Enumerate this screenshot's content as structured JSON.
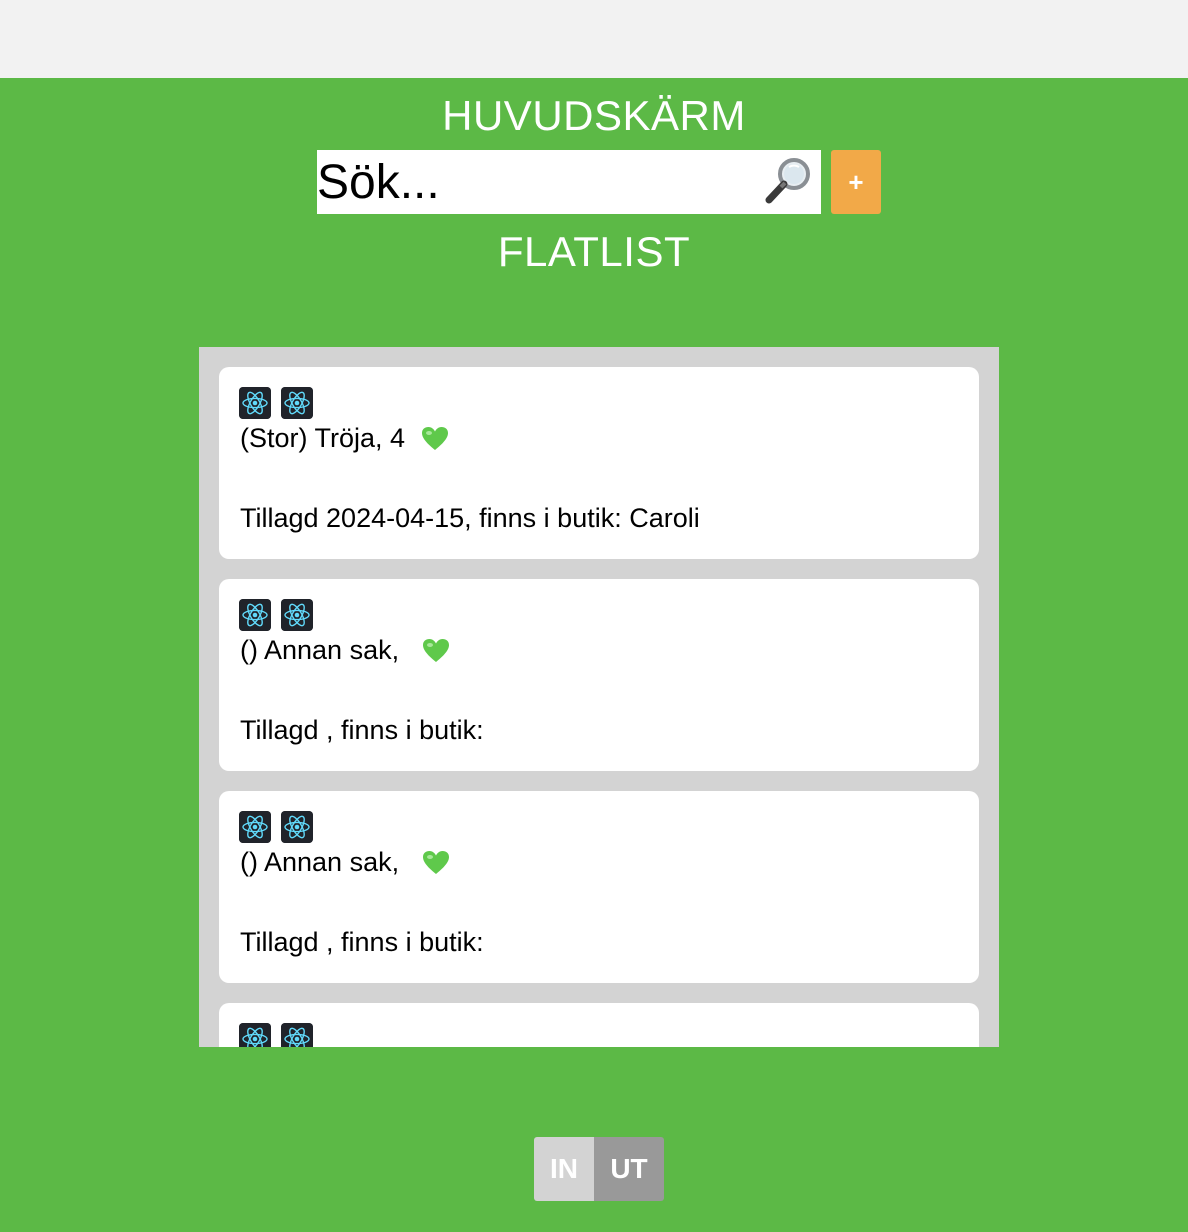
{
  "header": {
    "title": "HUVUDSKÄRM",
    "subtitle": "FLATLIST"
  },
  "search": {
    "placeholder": "Sök...",
    "value": "",
    "icon": "magnifier-icon"
  },
  "add_button": {
    "label": "+"
  },
  "items": [
    {
      "icons": [
        "react-icon",
        "react-icon"
      ],
      "line1": "(Stor) Tröja, 4 ",
      "heart_icon": "green-heart-icon",
      "line2": "Tillagd 2024-04-15, finns i butik: Caroli"
    },
    {
      "icons": [
        "react-icon",
        "react-icon"
      ],
      "line1": "() Annan sak,  ",
      "heart_icon": "green-heart-icon",
      "line2": "Tillagd , finns i butik:"
    },
    {
      "icons": [
        "react-icon",
        "react-icon"
      ],
      "line1": "() Annan sak,  ",
      "heart_icon": "green-heart-icon",
      "line2": "Tillagd , finns i butik:"
    },
    {
      "icons": [
        "react-icon",
        "react-icon"
      ],
      "line1": "",
      "heart_icon": "",
      "line2": ""
    }
  ],
  "toggle": {
    "in_label": "IN",
    "ut_label": "UT",
    "selected": "UT"
  },
  "colors": {
    "background": "#5cb946",
    "top_bar": "#f2f2f2",
    "add_button": "#f2a948",
    "list_background": "#d3d3d3",
    "card": "#ffffff",
    "toggle_in": "#d3d3d3",
    "toggle_ut": "#999999"
  }
}
